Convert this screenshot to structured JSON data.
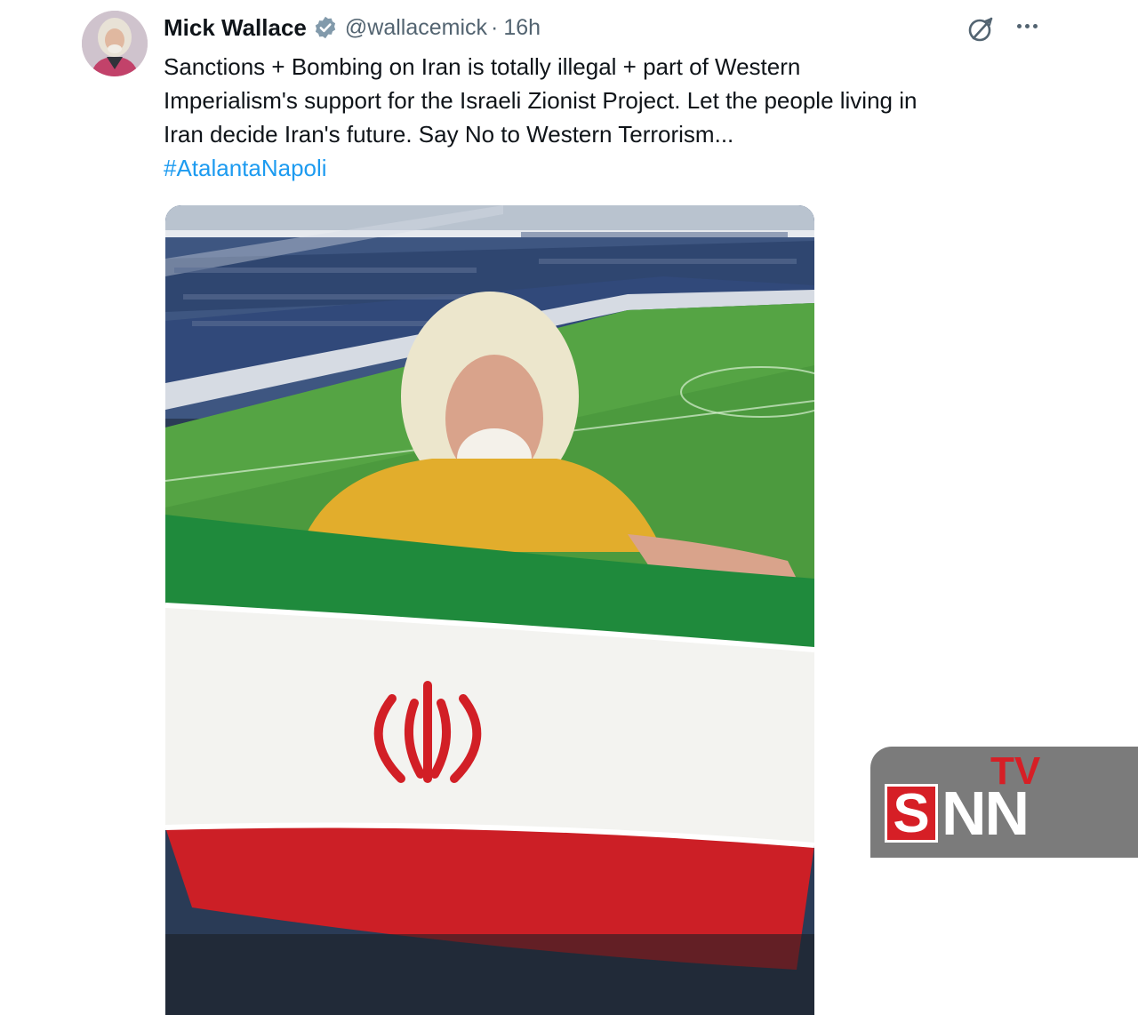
{
  "tweet": {
    "author_name": "Mick Wallace",
    "handle": "@wallacemick",
    "separator": "·",
    "time": "16h",
    "text_lines": [
      "Sanctions + Bombing on Iran is totally illegal + part of Western",
      "Imperialism's support for the Israeli Zionist Project. Let the people living in",
      "Iran decide Iran's future. Say No to Western Terrorism..."
    ],
    "hashtag": "#AtalantaNapoli",
    "icons": [
      "verified-badge-icon",
      "grok-icon",
      "more-icon"
    ],
    "colors": {
      "link": "#1d9bf0",
      "verified": "#829aab",
      "secondary_text": "#536471"
    }
  },
  "watermark": {
    "brand_letter": "S",
    "brand_rest": "NN",
    "brand_tv": "TV",
    "colors": {
      "background": "#7b7b7b",
      "red": "#d61f26",
      "white": "#ffffff"
    }
  }
}
